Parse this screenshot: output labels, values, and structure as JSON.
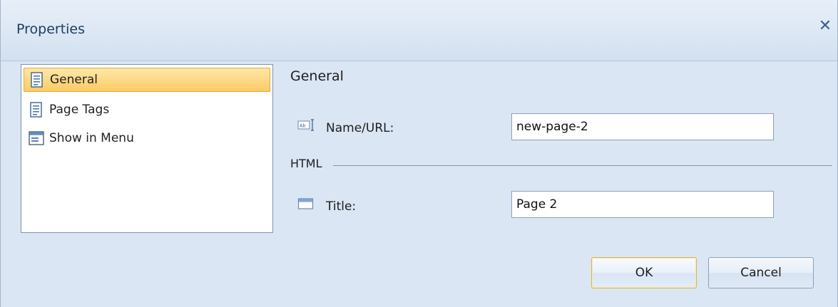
{
  "window": {
    "title": "Properties",
    "close_glyph": "✕"
  },
  "sidebar": {
    "items": [
      {
        "label": "General",
        "icon": "page-icon",
        "selected": true
      },
      {
        "label": "Page Tags",
        "icon": "page-icon",
        "selected": false
      },
      {
        "label": "Show in Menu",
        "icon": "menu-icon",
        "selected": false
      }
    ]
  },
  "main": {
    "section_title": "General",
    "name_field": {
      "label": "Name/URL:",
      "value": "new-page-2",
      "icon": "textbox-icon"
    },
    "group_label": "HTML",
    "title_field": {
      "label": "Title:",
      "value": "Page 2",
      "icon": "window-icon"
    }
  },
  "buttons": {
    "ok_label": "OK",
    "cancel_label": "Cancel"
  },
  "colors": {
    "accent_selected": "#fbcb65",
    "title_text": "#1f3c66",
    "dialog_bg": "#dae6f4"
  }
}
